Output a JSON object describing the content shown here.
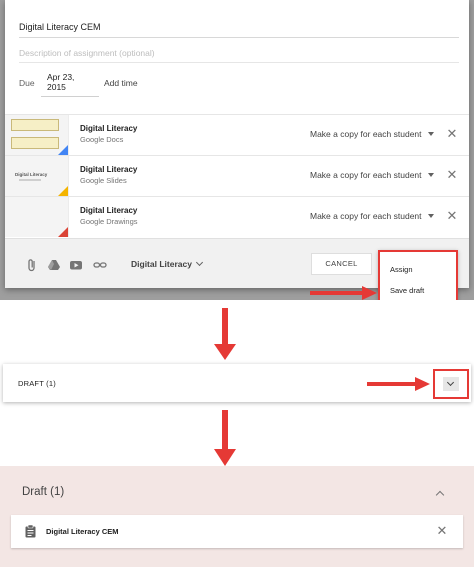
{
  "dialog": {
    "title_value": "Digital Literacy CEM",
    "description_placeholder": "Description of assignment (optional)",
    "due_label": "Due",
    "due_date": "Apr 23, 2015",
    "add_time_label": "Add time",
    "attachments": [
      {
        "name": "Digital Literacy",
        "type": "Google Docs",
        "permission": "Make a copy for each student",
        "corner_color": "#4285f4"
      },
      {
        "name": "Digital Literacy",
        "type": "Google Slides",
        "permission": "Make a copy for each student",
        "corner_color": "#f4b400"
      },
      {
        "name": "Digital Literacy",
        "type": "Google Drawings",
        "permission": "Make a copy for each student",
        "corner_color": "#db4437"
      }
    ],
    "slides_thumb_text": "Digital Literacy",
    "toolbar": {
      "class_name": "Digital Literacy",
      "cancel_label": "CANCEL"
    },
    "assign_menu": {
      "items": [
        "Assign",
        "Save draft"
      ]
    }
  },
  "draft_collapsed": {
    "label": "DRAFT (1)"
  },
  "draft_expanded": {
    "title": "Draft (1)",
    "item_name": "Digital Literacy CEM"
  },
  "colors": {
    "annotation_red": "#e53935",
    "expanded_bg": "#f3e6e4",
    "toolbar_bg": "#f1f1f1"
  }
}
